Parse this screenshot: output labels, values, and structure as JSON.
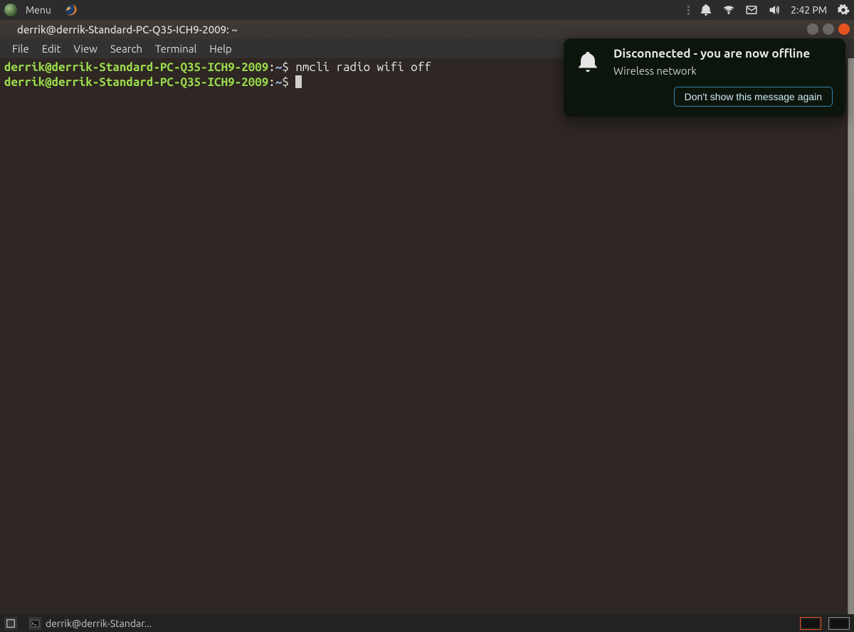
{
  "panel": {
    "menu_label": "Menu",
    "clock": "2:42 PM"
  },
  "window": {
    "title": "derrik@derrik-Standard-PC-Q35-ICH9-2009: ~"
  },
  "menubar": {
    "file": "File",
    "edit": "Edit",
    "view": "View",
    "search": "Search",
    "terminal": "Terminal",
    "help": "Help"
  },
  "terminal": {
    "line1": {
      "userhost": "derrik@derrik-Standard-PC-Q35-ICH9-2009",
      "colon": ":",
      "path": "~",
      "dollar": "$ ",
      "command": "nmcli radio wifi off"
    },
    "line2": {
      "userhost": "derrik@derrik-Standard-PC-Q35-ICH9-2009",
      "colon": ":",
      "path": "~",
      "dollar": "$ "
    }
  },
  "notification": {
    "title": "Disconnected - you are now offline",
    "body": "Wireless network",
    "button": "Don't show this message again"
  },
  "taskbar": {
    "entry_label": "derrik@derrik-Standar..."
  }
}
